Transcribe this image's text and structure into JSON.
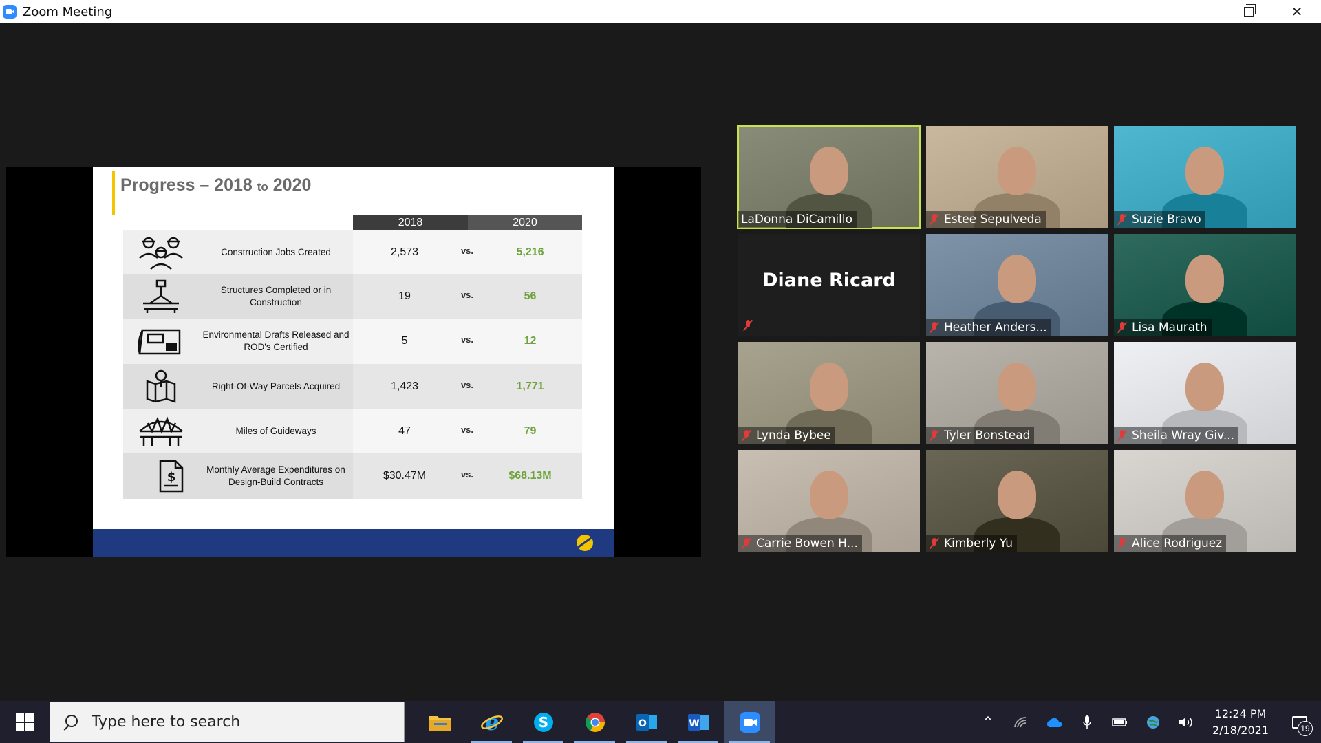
{
  "window": {
    "title": "Zoom Meeting",
    "icon": "zoom-icon"
  },
  "slide": {
    "title_part1": "Progress – 2018 ",
    "title_to": "to",
    "title_part2": " 2020",
    "col_2018": "2018",
    "col_2020": "2020",
    "vs_label": "vs.",
    "rows": [
      {
        "label": "Construction Jobs Created",
        "v2018": "2,573",
        "v2020": "5,216",
        "icon": "workers-icon"
      },
      {
        "label": "Structures Completed or in Construction",
        "v2018": "19",
        "v2020": "56",
        "icon": "crane-bridge-icon"
      },
      {
        "label": "Environmental Drafts Released and ROD's Certified",
        "v2018": "5",
        "v2020": "12",
        "icon": "map-document-icon"
      },
      {
        "label": "Right-Of-Way Parcels Acquired",
        "v2018": "1,423",
        "v2020": "1,771",
        "icon": "map-pin-icon"
      },
      {
        "label": "Miles of Guideways",
        "v2018": "47",
        "v2020": "79",
        "icon": "guideway-bridge-icon"
      },
      {
        "label": "Monthly Average Expenditures on Design-Build Contracts",
        "v2018": "$30.47M",
        "v2020": "$68.13M",
        "icon": "dollar-document-icon"
      }
    ]
  },
  "participants": [
    {
      "name": "LaDonna DiCamillo",
      "muted": false,
      "active": true,
      "bg": "#8a8c7a"
    },
    {
      "name": "Estee Sepulveda",
      "muted": true,
      "active": false,
      "bg": "#c9b89e"
    },
    {
      "name": "Suzie Bravo",
      "muted": true,
      "active": false,
      "bg": "#4fb7cf"
    },
    {
      "name": "Diane Ricard",
      "muted": true,
      "active": false,
      "video_off": true
    },
    {
      "name": "Heather Anders...",
      "muted": true,
      "active": false,
      "bg": "#7f93a8"
    },
    {
      "name": "Lisa Maurath",
      "muted": true,
      "active": false,
      "bg": "#2f6a5e"
    },
    {
      "name": "Lynda Bybee",
      "muted": true,
      "active": false,
      "bg": "#a7a38f"
    },
    {
      "name": "Tyler Bonstead",
      "muted": true,
      "active": false,
      "bg": "#b9b4ab"
    },
    {
      "name": "Sheila Wray Giv...",
      "muted": true,
      "active": false,
      "bg": "#eef0f4"
    },
    {
      "name": "Carrie Bowen H...",
      "muted": true,
      "active": false,
      "bg": "#c8bfb2"
    },
    {
      "name": "Kimberly Yu",
      "muted": true,
      "active": false,
      "bg": "#6a6656"
    },
    {
      "name": "Alice Rodriguez",
      "muted": true,
      "active": false,
      "bg": "#d9d6d1"
    }
  ],
  "taskbar": {
    "search_placeholder": "Type here to search",
    "apps": [
      "file-explorer-icon",
      "internet-explorer-icon",
      "skype-icon",
      "chrome-icon",
      "outlook-icon",
      "word-icon",
      "zoom-icon"
    ],
    "time": "12:24 PM",
    "date": "2/18/2021",
    "notification_count": "19"
  },
  "colors": {
    "accent_2020": "#6da33a",
    "slide_footer": "#1f3a80",
    "active_speaker": "#c7e34a"
  }
}
